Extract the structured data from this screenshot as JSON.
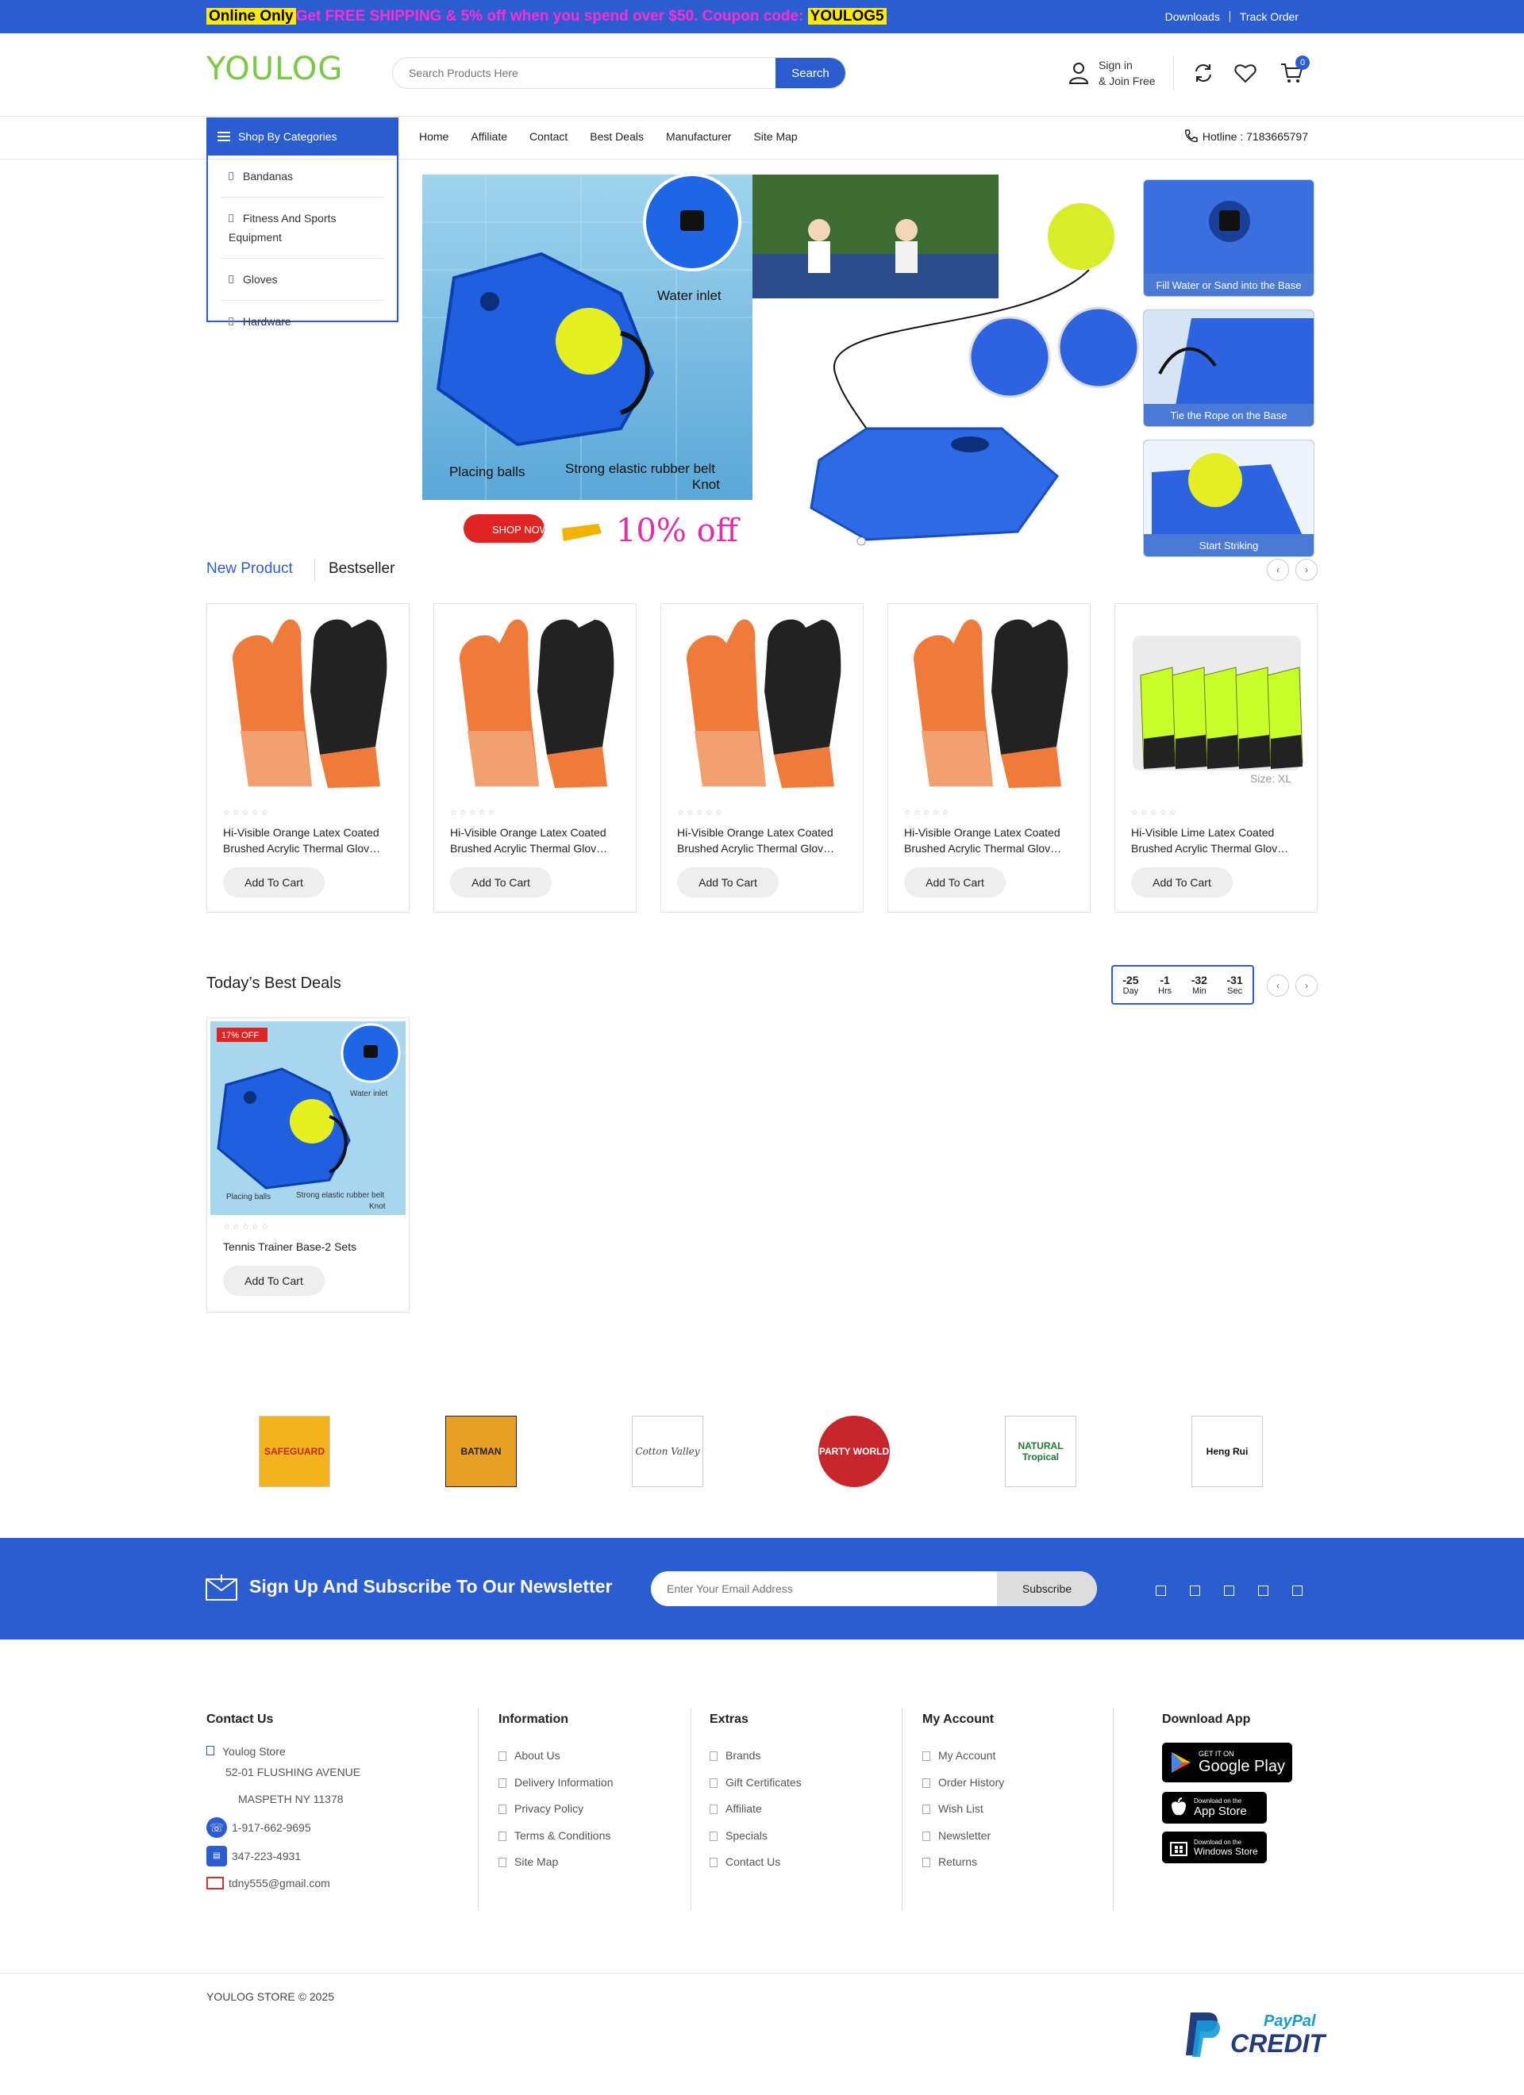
{
  "topbar": {
    "badge_left": "Online Only",
    "promo_text": "Get FREE SHIPPING & 5% off when you spend over $50. Coupon code: ",
    "coupon": "YOULOG5",
    "links": [
      "Downloads",
      "Track Order"
    ]
  },
  "header": {
    "logo": "YOULOG",
    "search_placeholder": "Search Products Here",
    "search_button": "Search",
    "signin_line1": "Sign in",
    "signin_line2": "& Join Free",
    "cart_count": "0"
  },
  "nav": {
    "categories_label": "Shop By Categories",
    "categories": [
      "Bandanas",
      "Fitness And Sports Equipment",
      "Gloves",
      "Hardware"
    ],
    "menu": [
      "Home",
      "Affiliate",
      "Contact",
      "Best Deals",
      "Manufacturer",
      "Site Map"
    ],
    "hotline": "Hotline : 7183665797"
  },
  "banner": {
    "labels": [
      "Water inlet",
      "Placing balls",
      "Strong elastic rubber belt",
      "Knot"
    ],
    "shop_now": "SHOP NOW",
    "discount": "10%  off",
    "thumb_captions": [
      "Fill Water or Sand into the Base",
      "Tie the Rope on the Base",
      "Start Striking"
    ]
  },
  "tabs": [
    "New Product",
    "Bestseller"
  ],
  "products": [
    {
      "name": "Hi-Visible Orange Latex Coated Brushed Acrylic Thermal Glov…",
      "button": "Add To Cart",
      "color": "#f07a3a"
    },
    {
      "name": "Hi-Visible Orange Latex Coated Brushed Acrylic Thermal Glov…",
      "button": "Add To Cart",
      "color": "#f07a3a"
    },
    {
      "name": "Hi-Visible Orange Latex Coated Brushed Acrylic Thermal Glov…",
      "button": "Add To Cart",
      "color": "#f07a3a"
    },
    {
      "name": "Hi-Visible Orange Latex Coated Brushed Acrylic Thermal Glov…",
      "button": "Add To Cart",
      "color": "#f07a3a"
    },
    {
      "name": "Hi-Visible Lime Latex Coated Brushed Acrylic Thermal Glov…",
      "button": "Add To Cart",
      "color": "#c8ff2a",
      "size_label": "Size: XL"
    }
  ],
  "deals": {
    "title": "Today’s Best Deals",
    "timer": [
      {
        "value": "-25",
        "unit": "Day"
      },
      {
        "value": "-1",
        "unit": "Hrs"
      },
      {
        "value": "-32",
        "unit": "Min"
      },
      {
        "value": "-31",
        "unit": "Sec"
      }
    ],
    "product": {
      "badge": "17% OFF",
      "name": "Tennis Trainer Base-2 Sets",
      "button": "Add To Cart",
      "labels": [
        "Water inlet",
        "Placing balls",
        "Strong elastic rubber belt",
        "Knot"
      ]
    }
  },
  "brands": [
    "SAFEGUARD",
    "BATMAN",
    "Cotton Valley",
    "PARTY WORLD",
    "NATURAL Tropical",
    "Heng Rui"
  ],
  "newsletter": {
    "title": "Sign Up And Subscribe To Our Newsletter",
    "placeholder": "Enter Your Email Address",
    "button": "Subscribe"
  },
  "footer": {
    "contact": {
      "title": "Contact Us",
      "store": "Youlog Store",
      "address1": "52-01 FLUSHING AVENUE",
      "address2": "MASPETH NY 11378",
      "phone": "1-917-662-9695",
      "fax": "347-223-4931",
      "email": "tdny555@gmail.com"
    },
    "information": {
      "title": "Information",
      "links": [
        "About Us",
        "Delivery Information",
        "Privacy Policy",
        "Terms & Conditions",
        "Site Map"
      ]
    },
    "extras": {
      "title": "Extras",
      "links": [
        "Brands",
        "Gift Certificates",
        "Affiliate",
        "Specials",
        "Contact Us"
      ]
    },
    "account": {
      "title": "My Account",
      "links": [
        "My Account",
        "Order History",
        "Wish List",
        "Newsletter",
        "Returns"
      ]
    },
    "app": {
      "title": "Download App",
      "google_small": "GET IT ON",
      "google_big": "Google Play",
      "apple_small": "Download on the",
      "apple_big": "App Store",
      "windows_small": "Download on the",
      "windows_big": "Windows Store"
    },
    "copyright": "YOULOG STORE © 2025",
    "paypal_line1": "PayPal",
    "paypal_line2": "CREDIT"
  },
  "colors": {
    "brand_blue": "#2c5dd0",
    "logo_green": "#7ac943",
    "promo_pink": "#ff2bd6",
    "highlight_yellow": "#ffeb00"
  }
}
